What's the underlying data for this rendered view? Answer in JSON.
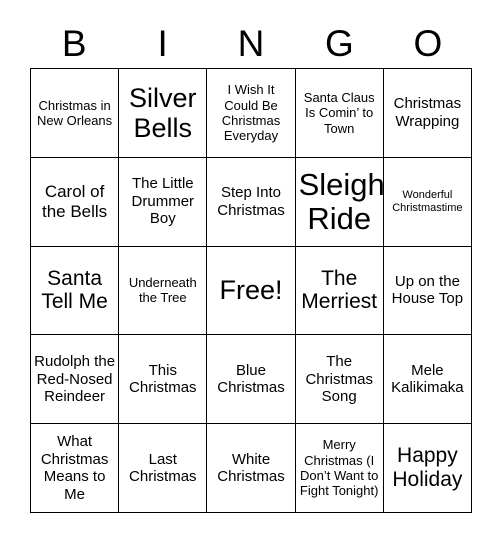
{
  "header": {
    "letters": [
      "B",
      "I",
      "N",
      "G",
      "O"
    ]
  },
  "grid": {
    "rows": 5,
    "columns": 5,
    "free_space_label": "Free!",
    "cells": [
      {
        "label": "Christmas in New Orleans",
        "size": "s"
      },
      {
        "label": "Silver Bells",
        "size": "xxl"
      },
      {
        "label": "I Wish It Could Be Christmas Everyday",
        "size": "s"
      },
      {
        "label": "Santa Claus Is Comin’ to Town",
        "size": "s"
      },
      {
        "label": "Christmas Wrapping",
        "size": "m"
      },
      {
        "label": "Carol of the Bells",
        "size": "l"
      },
      {
        "label": "The Little Drummer Boy",
        "size": "m"
      },
      {
        "label": "Step Into Christmas",
        "size": "m"
      },
      {
        "label": "Sleigh Ride",
        "size": "huge"
      },
      {
        "label": "Wonderful Christmastime",
        "size": "xs"
      },
      {
        "label": "Santa Tell Me",
        "size": "xl"
      },
      {
        "label": "Underneath the Tree",
        "size": "s"
      },
      {
        "label": "Free!",
        "size": "xxl"
      },
      {
        "label": "The Merriest",
        "size": "xl"
      },
      {
        "label": "Up on the House Top",
        "size": "m"
      },
      {
        "label": "Rudolph the Red-Nosed Reindeer",
        "size": "m"
      },
      {
        "label": "This Christmas",
        "size": "m"
      },
      {
        "label": "Blue Christmas",
        "size": "m"
      },
      {
        "label": "The Christmas Song",
        "size": "m"
      },
      {
        "label": "Mele Kalikimaka",
        "size": "m"
      },
      {
        "label": "What Christmas Means to Me",
        "size": "m"
      },
      {
        "label": "Last Christmas",
        "size": "m"
      },
      {
        "label": "White Christmas",
        "size": "m"
      },
      {
        "label": "Merry Christmas (I Don’t Want to Fight Tonight)",
        "size": "s"
      },
      {
        "label": "Happy Holiday",
        "size": "xl"
      }
    ]
  },
  "colors": {
    "background": "#ffffff",
    "text": "#000000",
    "border": "#000000"
  }
}
